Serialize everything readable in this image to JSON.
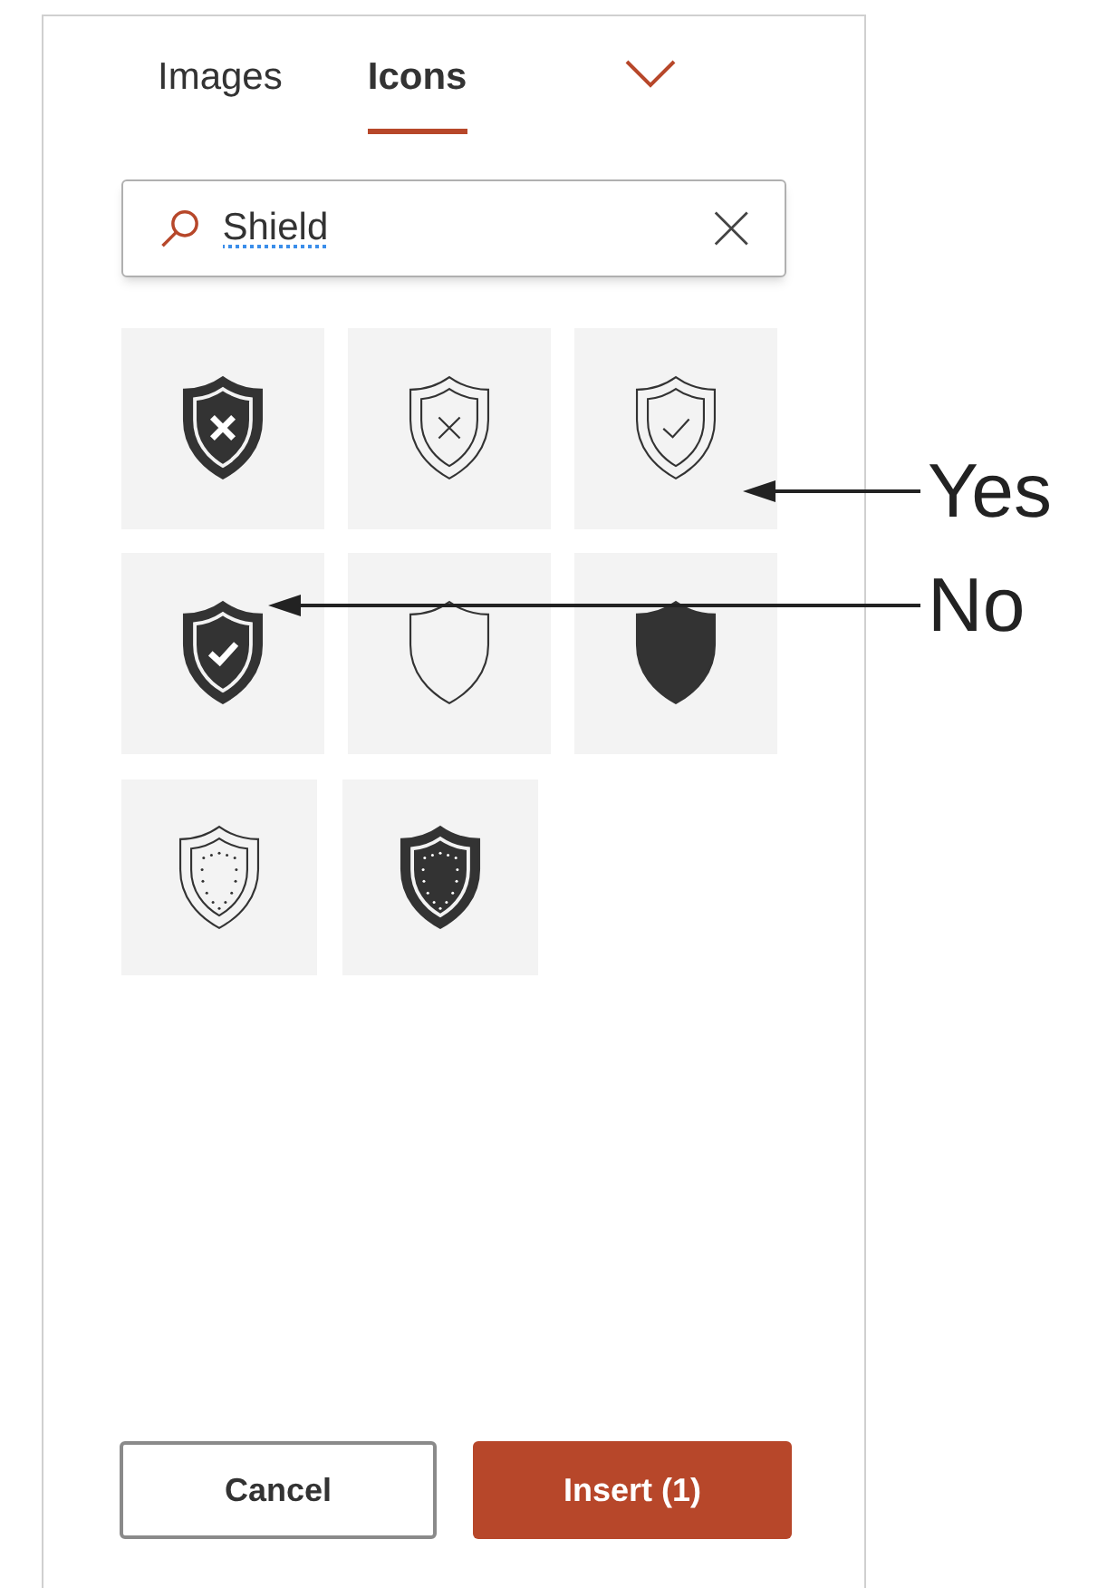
{
  "tabs": [
    {
      "label": "Images",
      "selected": false
    },
    {
      "label": "Icons",
      "selected": true
    }
  ],
  "search": {
    "value": "Shield"
  },
  "icons": [
    {
      "kind": "x-solid"
    },
    {
      "kind": "x-outline"
    },
    {
      "kind": "check-outline"
    },
    {
      "kind": "check-solid"
    },
    {
      "kind": "plain-outline"
    },
    {
      "kind": "plain-solid"
    },
    {
      "kind": "dotted-outline"
    },
    {
      "kind": "dotted-solid"
    }
  ],
  "buttons": {
    "cancel": "Cancel",
    "insert": "Insert (1)"
  },
  "annotations": [
    {
      "label": "Yes"
    },
    {
      "label": "No"
    }
  ]
}
